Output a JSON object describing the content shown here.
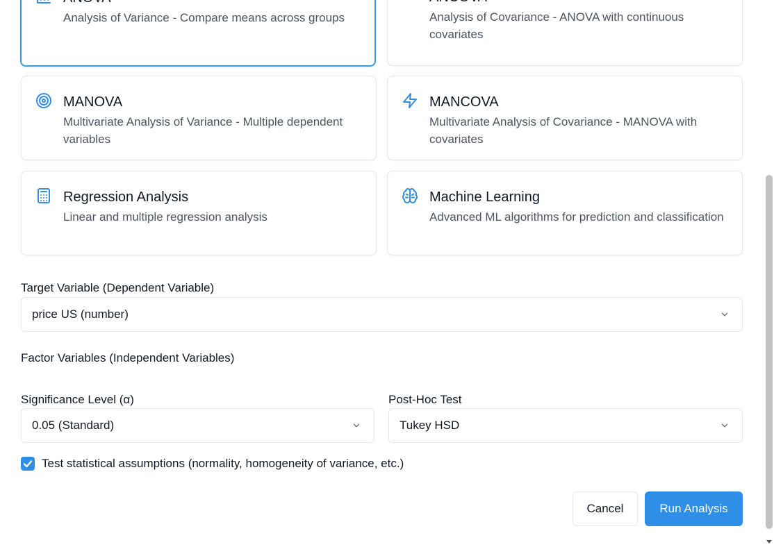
{
  "cards": [
    {
      "title": "ANOVA",
      "desc": "Analysis of Variance - Compare means across groups",
      "icon": "bar-chart-icon",
      "selected": true
    },
    {
      "title": "ANCOVA",
      "desc": "Analysis of Covariance - ANOVA with continuous covariates",
      "icon": "trending-up-icon"
    },
    {
      "title": "MANOVA",
      "desc": "Multivariate Analysis of Variance - Multiple dependent variables",
      "icon": "target-icon"
    },
    {
      "title": "MANCOVA",
      "desc": "Multivariate Analysis of Covariance - MANOVA with covariates",
      "icon": "lightning-icon"
    },
    {
      "title": "Regression Analysis",
      "desc": "Linear and multiple regression analysis",
      "icon": "calculator-icon"
    },
    {
      "title": "Machine Learning",
      "desc": "Advanced ML algorithms for prediction and classification",
      "icon": "brain-icon"
    }
  ],
  "form": {
    "target_label": "Target Variable (Dependent Variable)",
    "target_value": "price US (number)",
    "factor_label": "Factor Variables (Independent Variables)",
    "significance_label": "Significance Level (α)",
    "significance_value": "0.05 (Standard)",
    "posthoc_label": "Post-Hoc Test",
    "posthoc_value": "Tukey HSD",
    "assumptions_label": "Test statistical assumptions (normality, homogeneity of variance, etc.)",
    "assumptions_checked": true
  },
  "actions": {
    "cancel_label": "Cancel",
    "run_label": "Run Analysis"
  },
  "colors": {
    "accent": "#2f8ee5",
    "selected_border": "#3b9ae1",
    "icon": "#2f8ee5"
  }
}
